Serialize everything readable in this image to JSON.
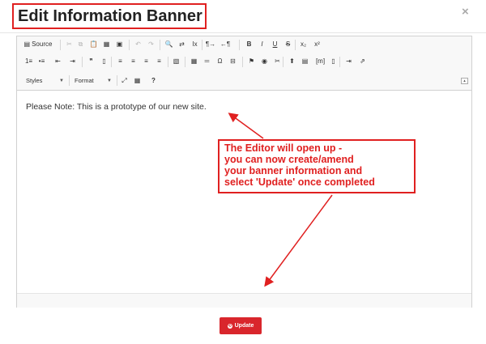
{
  "dialog": {
    "title": "Edit Information Banner",
    "close_icon": "×"
  },
  "toolbar": {
    "row1": [
      {
        "name": "source-button",
        "icon": "▤",
        "label": "Source",
        "disabled": false
      },
      {
        "name": "cut-button",
        "icon": "✂",
        "disabled": true
      },
      {
        "name": "copy-button",
        "icon": "⧉",
        "disabled": true
      },
      {
        "name": "paste-button",
        "icon": "📋",
        "disabled": false
      },
      {
        "name": "paste-text-button",
        "icon": "▦",
        "disabled": false
      },
      {
        "name": "paste-word-button",
        "icon": "▣",
        "disabled": false
      },
      {
        "name": "undo-button",
        "icon": "↶",
        "disabled": true
      },
      {
        "name": "redo-button",
        "icon": "↷",
        "disabled": true
      },
      {
        "name": "find-button",
        "icon": "🔍",
        "disabled": false
      },
      {
        "name": "replace-button",
        "icon": "⇄",
        "disabled": false
      },
      {
        "name": "remove-format-button",
        "icon": "Ix",
        "disabled": false
      },
      {
        "name": "ltr-button",
        "icon": "¶→",
        "disabled": false
      },
      {
        "name": "rtl-button",
        "icon": "←¶",
        "disabled": false
      },
      {
        "name": "bold-button",
        "icon": "B",
        "disabled": false
      },
      {
        "name": "italic-button",
        "icon": "I",
        "disabled": false
      },
      {
        "name": "underline-button",
        "icon": "U",
        "disabled": false
      },
      {
        "name": "strike-button",
        "icon": "S",
        "disabled": false
      },
      {
        "name": "subscript-button",
        "icon": "x₂",
        "disabled": false
      },
      {
        "name": "superscript-button",
        "icon": "x²",
        "disabled": false
      }
    ],
    "row2": [
      {
        "name": "numbered-list-button",
        "icon": "1≡"
      },
      {
        "name": "bulleted-list-button",
        "icon": "•≡"
      },
      {
        "name": "outdent-button",
        "icon": "⇤"
      },
      {
        "name": "indent-button",
        "icon": "⇥"
      },
      {
        "name": "blockquote-button",
        "icon": "❞"
      },
      {
        "name": "div-button",
        "icon": "▯"
      },
      {
        "name": "align-left-button",
        "icon": "≡"
      },
      {
        "name": "align-center-button",
        "icon": "≡"
      },
      {
        "name": "align-right-button",
        "icon": "≡"
      },
      {
        "name": "justify-button",
        "icon": "≡"
      },
      {
        "name": "image-button",
        "icon": "▧"
      },
      {
        "name": "table-button",
        "icon": "▦"
      },
      {
        "name": "horizontal-line-button",
        "icon": "═"
      },
      {
        "name": "special-char-button",
        "icon": "Ω"
      },
      {
        "name": "page-break-button",
        "icon": "⊟"
      },
      {
        "name": "anchor-button",
        "icon": "⚑"
      },
      {
        "name": "link-button",
        "icon": "◉"
      },
      {
        "name": "unlink-button",
        "icon": "✂"
      },
      {
        "name": "upload-button",
        "icon": "⬆"
      },
      {
        "name": "doc-button",
        "icon": "▤"
      },
      {
        "name": "placeholder-button",
        "icon": "[m]"
      },
      {
        "name": "media-button",
        "icon": "▯"
      },
      {
        "name": "template-button",
        "icon": "⇥"
      },
      {
        "name": "export-button",
        "icon": "⇗"
      }
    ],
    "row3": {
      "styles_label": "Styles",
      "format_label": "Format",
      "maximize_icon": "⤢",
      "blocks_icon": "▦",
      "help_icon": "?"
    },
    "collapse_icon": "▴"
  },
  "editor": {
    "content": "Please Note: This is a prototype of our new site."
  },
  "callout": {
    "lines": [
      "The Editor will open up -",
      "you can now create/amend",
      "your banner information and",
      "select 'Update' once completed"
    ]
  },
  "footer": {
    "update_label": "Update",
    "update_icon": "⟲"
  },
  "colors": {
    "accent_red": "#e02020",
    "button_red": "#d9262c"
  }
}
